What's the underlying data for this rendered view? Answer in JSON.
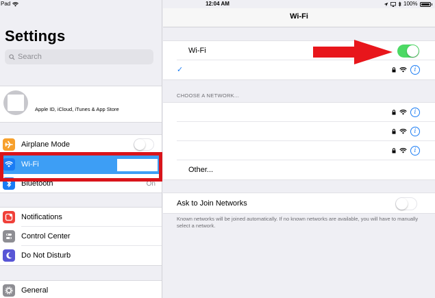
{
  "status_bar": {
    "device": "Pad",
    "time": "12:04 AM",
    "battery": "100%"
  },
  "sidebar": {
    "title": "Settings",
    "search_placeholder": "Search",
    "profile": {
      "name": "",
      "subtitle": "Apple ID, iCloud, iTunes & App Store"
    },
    "items": [
      {
        "label": "Airplane Mode",
        "icon": "airplane-icon",
        "color": "#f7a02c"
      },
      {
        "label": "Wi-Fi",
        "icon": "wifi-icon",
        "color": "#1a7cf4"
      },
      {
        "label": "Bluetooth",
        "icon": "bluetooth-icon",
        "color": "#1a7cf4",
        "value": "On"
      },
      {
        "label": "Notifications",
        "icon": "notifications-icon",
        "color": "#f0413a"
      },
      {
        "label": "Control Center",
        "icon": "control-center-icon",
        "color": "#8e8e93"
      },
      {
        "label": "Do Not Disturb",
        "icon": "moon-icon",
        "color": "#5856d6"
      },
      {
        "label": "General",
        "icon": "gear-icon",
        "color": "#8e8e93"
      }
    ]
  },
  "detail": {
    "nav_title": "Wi-Fi",
    "wifi_label": "Wi-Fi",
    "wifi_on": true,
    "connected_network": "",
    "choose_network_label": "CHOOSE A NETWORK...",
    "networks": [
      "",
      "",
      ""
    ],
    "other_label": "Other...",
    "ask_to_join_label": "Ask to Join Networks",
    "ask_to_join_on": false,
    "ask_to_join_description": "Known networks will be joined automatically. If no known networks are available, you will have to manually select a network."
  },
  "colors": {
    "selection": "#3d9ef5",
    "toggle_on": "#4cd964",
    "highlight_red": "#d9141a",
    "accent_blue": "#1a7cf4"
  }
}
